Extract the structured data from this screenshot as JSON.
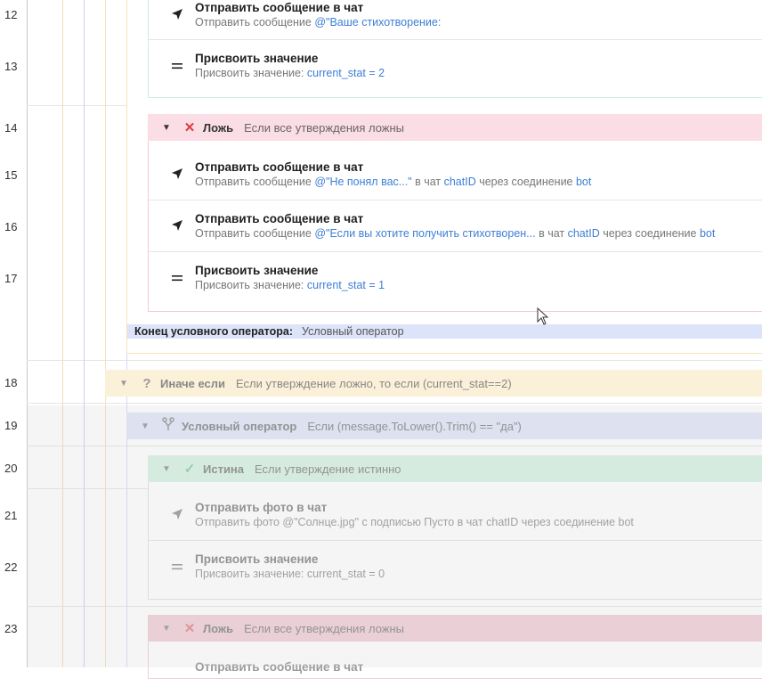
{
  "line_numbers": [
    "12",
    "13",
    "14",
    "15",
    "16",
    "17",
    "18",
    "19",
    "20",
    "21",
    "22",
    "23"
  ],
  "blocks": {
    "send_poem": {
      "title": "Отправить сообщение в чат",
      "prefix": "Отправить сообщение ",
      "value": "@\"Ваше стихотворение:"
    },
    "assign_2": {
      "title": "Присвоить значение",
      "prefix": "Присвоить значение: ",
      "value": "current_stat = 2"
    },
    "false_1": {
      "title": "Ложь",
      "subtitle": "Если все утверждения ложны"
    },
    "send_not_understood": {
      "title": "Отправить сообщение в чат",
      "prefix": "Отправить сообщение ",
      "value": "@\"Не понял вас...\"",
      "mid1": " в чат ",
      "chat": "chatID",
      "mid2": " через соединение ",
      "bot": "bot"
    },
    "send_if_want": {
      "title": "Отправить сообщение в чат",
      "prefix": "Отправить сообщение ",
      "value": "@\"Если вы хотите получить стихотворен...",
      "mid1": " в чат ",
      "chat": "chatID",
      "mid2": " через соединение ",
      "bot": "bot"
    },
    "assign_1": {
      "title": "Присвоить значение",
      "prefix": "Присвоить значение: ",
      "value": "current_stat = 1"
    },
    "end_cond": {
      "label": "Конец условного оператора:",
      "value": "Условный оператор"
    },
    "else_if": {
      "title": "Иначе если",
      "subtitle": "Если утверждение ложно, то если (current_stat==2)"
    },
    "cond_op": {
      "title": "Условный оператор",
      "subtitle": "Если (message.ToLower().Trim() == \"да\")"
    },
    "true_1": {
      "title": "Истина",
      "subtitle": "Если утверждение истинно"
    },
    "send_photo": {
      "title": "Отправить фото в чат",
      "desc": "Отправить фото @\"Солнце.jpg\" с подписью Пусто в чат chatID через соединение bot"
    },
    "assign_0": {
      "title": "Присвоить значение",
      "desc": "Присвоить значение: current_stat = 0"
    },
    "false_2": {
      "title": "Ложь",
      "subtitle": "Если все утверждения ложны"
    },
    "send_cut": {
      "title": "Отправить сообщение в чат"
    }
  },
  "icons": {
    "send": "send-arrow-icon",
    "assign": "equals-icon",
    "false": "cross-icon",
    "true": "check-icon",
    "else_if": "question-icon",
    "cond": "branch-icon",
    "collapse": "triangle-down-icon"
  },
  "colors": {
    "false_header": "#fbdde5",
    "true_header": "#daf3e6",
    "else_if_header": "#fbf0d8",
    "cond_header": "#e2e7f9",
    "end_bar": "#dde3f8",
    "link": "#3d7fd6",
    "cross": "#e03b3b",
    "check": "#5dbb82"
  }
}
